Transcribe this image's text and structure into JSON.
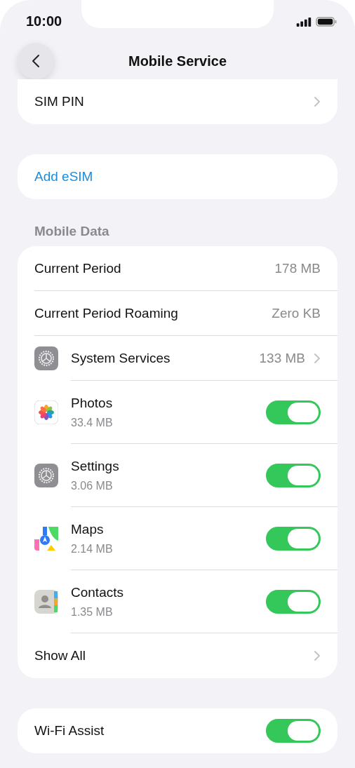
{
  "status_bar": {
    "time": "10:00"
  },
  "nav": {
    "title": "Mobile Service"
  },
  "sim_group": {
    "items": [
      {
        "label": "SIM PIN"
      }
    ]
  },
  "esim_group": {
    "items": [
      {
        "label": "Add eSIM"
      }
    ]
  },
  "mobile_data": {
    "header": "Mobile Data",
    "rows": [
      {
        "kind": "value",
        "label": "Current Period",
        "value": "178 MB"
      },
      {
        "kind": "value",
        "label": "Current Period Roaming",
        "value": "Zero KB"
      },
      {
        "kind": "link",
        "label": "System Services",
        "value": "133 MB"
      },
      {
        "kind": "app",
        "label": "Photos",
        "usage": "33.4 MB",
        "on": true
      },
      {
        "kind": "app",
        "label": "Settings",
        "usage": "3.06 MB",
        "on": true
      },
      {
        "kind": "app",
        "label": "Maps",
        "usage": "2.14 MB",
        "on": true
      },
      {
        "kind": "app",
        "label": "Contacts",
        "usage": "1.35 MB",
        "on": true
      },
      {
        "kind": "link",
        "label": "Show All"
      }
    ]
  },
  "wifi_group": {
    "rows": [
      {
        "label": "Wi-Fi Assist",
        "on": true
      }
    ]
  }
}
